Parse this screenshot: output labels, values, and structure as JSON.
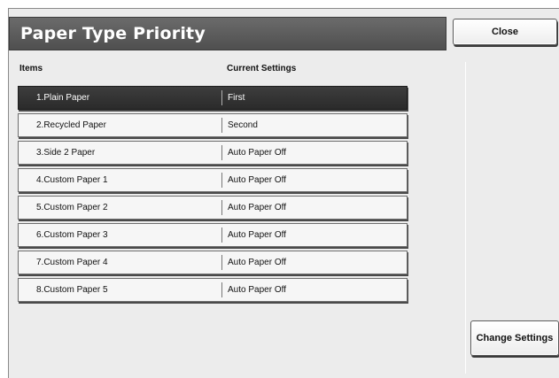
{
  "window": {
    "title": "Paper Type Priority"
  },
  "buttons": {
    "close_label": "Close",
    "change_label": "Change Settings"
  },
  "table": {
    "headers": {
      "items": "Items",
      "current": "Current Settings"
    },
    "rows": [
      {
        "item": "1.Plain Paper",
        "setting": "First",
        "selected": true
      },
      {
        "item": "2.Recycled Paper",
        "setting": "Second",
        "selected": false
      },
      {
        "item": "3.Side 2 Paper",
        "setting": "Auto Paper Off",
        "selected": false
      },
      {
        "item": "4.Custom Paper 1",
        "setting": "Auto Paper Off",
        "selected": false
      },
      {
        "item": "5.Custom Paper 2",
        "setting": "Auto Paper Off",
        "selected": false
      },
      {
        "item": "6.Custom Paper 3",
        "setting": "Auto Paper Off",
        "selected": false
      },
      {
        "item": "7.Custom Paper 4",
        "setting": "Auto Paper Off",
        "selected": false
      },
      {
        "item": "8.Custom Paper 5",
        "setting": "Auto Paper Off",
        "selected": false
      }
    ]
  }
}
